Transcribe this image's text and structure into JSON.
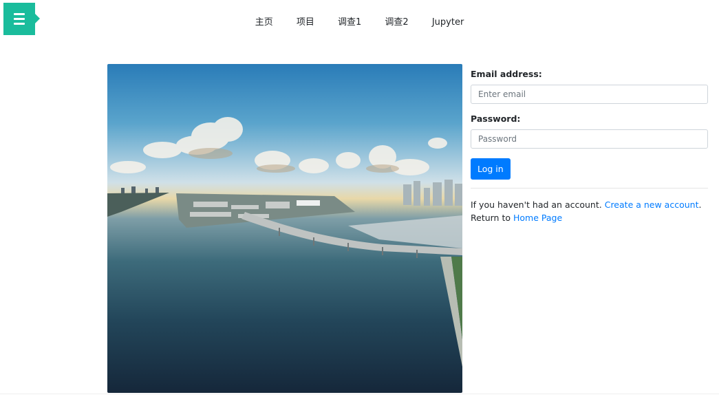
{
  "menu": {
    "icon": "hamburger-menu-icon",
    "color": "#1abc9c"
  },
  "nav": {
    "items": [
      "主页",
      "项目",
      "调查1",
      "调查2",
      "Jupyter"
    ]
  },
  "hero": {
    "alt": "Aerial view of city waterfront with bridge and marina"
  },
  "login": {
    "email_label": "Email address:",
    "email_placeholder": "Enter email",
    "email_value": "",
    "password_label": "Password:",
    "password_placeholder": "Password",
    "password_value": "",
    "submit_label": "Log in",
    "submit_color": "#007bff"
  },
  "notes": {
    "signup_prefix": "If you haven't had an account.",
    "signup_link": "Create a new account",
    "signup_suffix": ".",
    "return_prefix": "Return to",
    "return_link": "Home Page",
    "link_color": "#007bff"
  }
}
